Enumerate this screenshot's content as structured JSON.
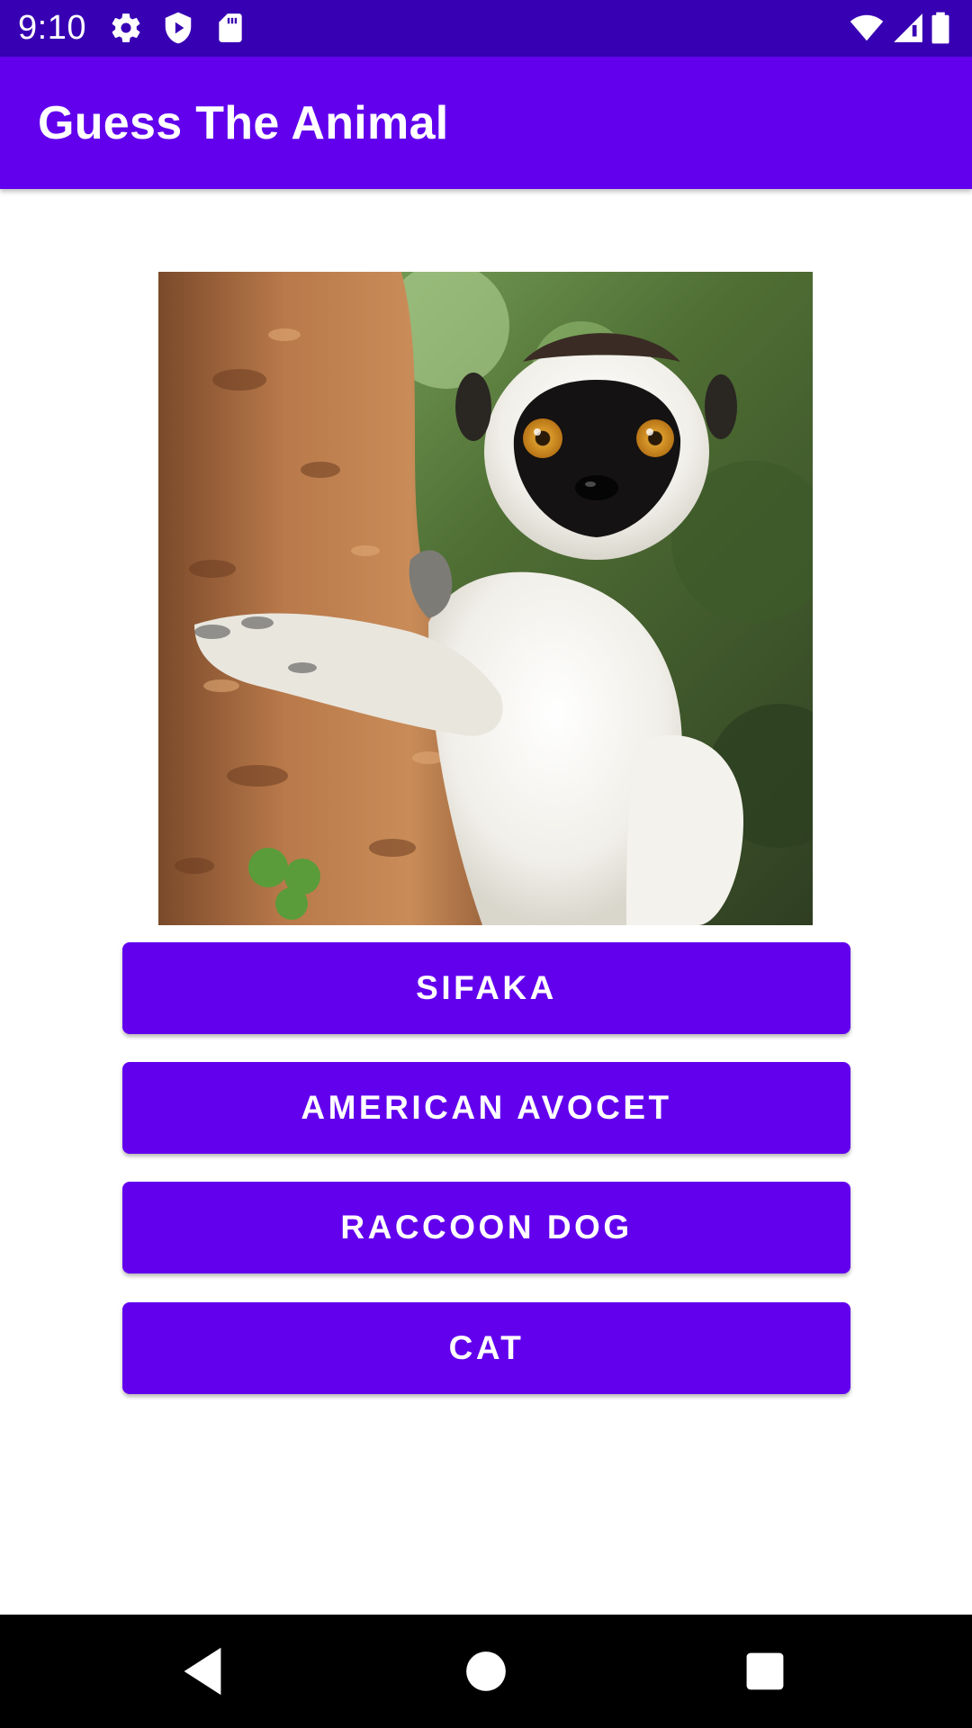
{
  "status_bar": {
    "time": "9:10",
    "icons": [
      "gear-icon",
      "shield-play-icon",
      "sd-card-icon",
      "wifi-icon",
      "cell-signal-icon",
      "battery-icon"
    ]
  },
  "app_bar": {
    "title": "Guess The Animal"
  },
  "quiz": {
    "image_subject": "sifaka lemur on tree trunk",
    "answers": [
      {
        "label": "SIFAKA"
      },
      {
        "label": "AMERICAN AVOCET"
      },
      {
        "label": "RACCOON DOG"
      },
      {
        "label": "CAT"
      }
    ]
  },
  "nav_bar": {
    "buttons": [
      "back-icon",
      "home-icon",
      "recents-icon"
    ]
  },
  "colors": {
    "status_bar": "#3700b3",
    "primary": "#6200ee",
    "on_primary": "#ffffff",
    "background": "#ffffff",
    "nav_bar": "#000000"
  }
}
